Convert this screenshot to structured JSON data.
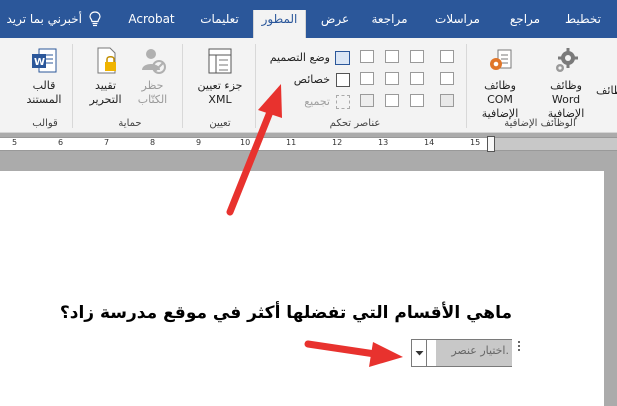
{
  "tabs": [
    {
      "label": "تخطيط"
    },
    {
      "label": "مراجع"
    },
    {
      "label": "مراسلات"
    },
    {
      "label": "مراجعة"
    },
    {
      "label": "عرض"
    },
    {
      "label": "المطور",
      "active": true
    },
    {
      "label": "تعليمات"
    },
    {
      "label": "Acrobat"
    },
    {
      "label": "أخبرني بما تريد"
    }
  ],
  "ribbon": {
    "addins": {
      "group_label": "الوظائف الإضافية",
      "word_addins": "وظائف Word الإضافية",
      "com_addins": "وظائف COM الإضافية",
      "partial_label": "وظائف"
    },
    "controls": {
      "group_label": "عناصر تحكم",
      "design_mode": "وضع التصميم",
      "properties": "خصائص",
      "group": "تجميع"
    },
    "mapping": {
      "group_label": "تعيين",
      "xml_pane_line1": "جزء تعيين",
      "xml_pane_line2": "XML"
    },
    "protect": {
      "group_label": "حماية",
      "block_authors_line1": "حظر",
      "block_authors_line2": "الكتّاب",
      "restrict_line1": "تقييد",
      "restrict_line2": "التحرير"
    },
    "templates": {
      "group_label": "قوالب",
      "doc_template_line1": "قالب",
      "doc_template_line2": "المستند"
    }
  },
  "ruler": {
    "numbers": [
      "5",
      "6",
      "7",
      "8",
      "9",
      "10",
      "11",
      "12",
      "13",
      "14",
      "15"
    ]
  },
  "document": {
    "question": "ماهي الأقسام التي تفضلها أكثر في موقع مدرسة زاد؟",
    "dropdown_placeholder": "اختيار عنصر."
  },
  "colors": {
    "tab_bar": "#2b579a",
    "ribbon": "#f3f3f3",
    "arrow": "#e8322e",
    "dropdown_fill": "#c8c8c8"
  }
}
